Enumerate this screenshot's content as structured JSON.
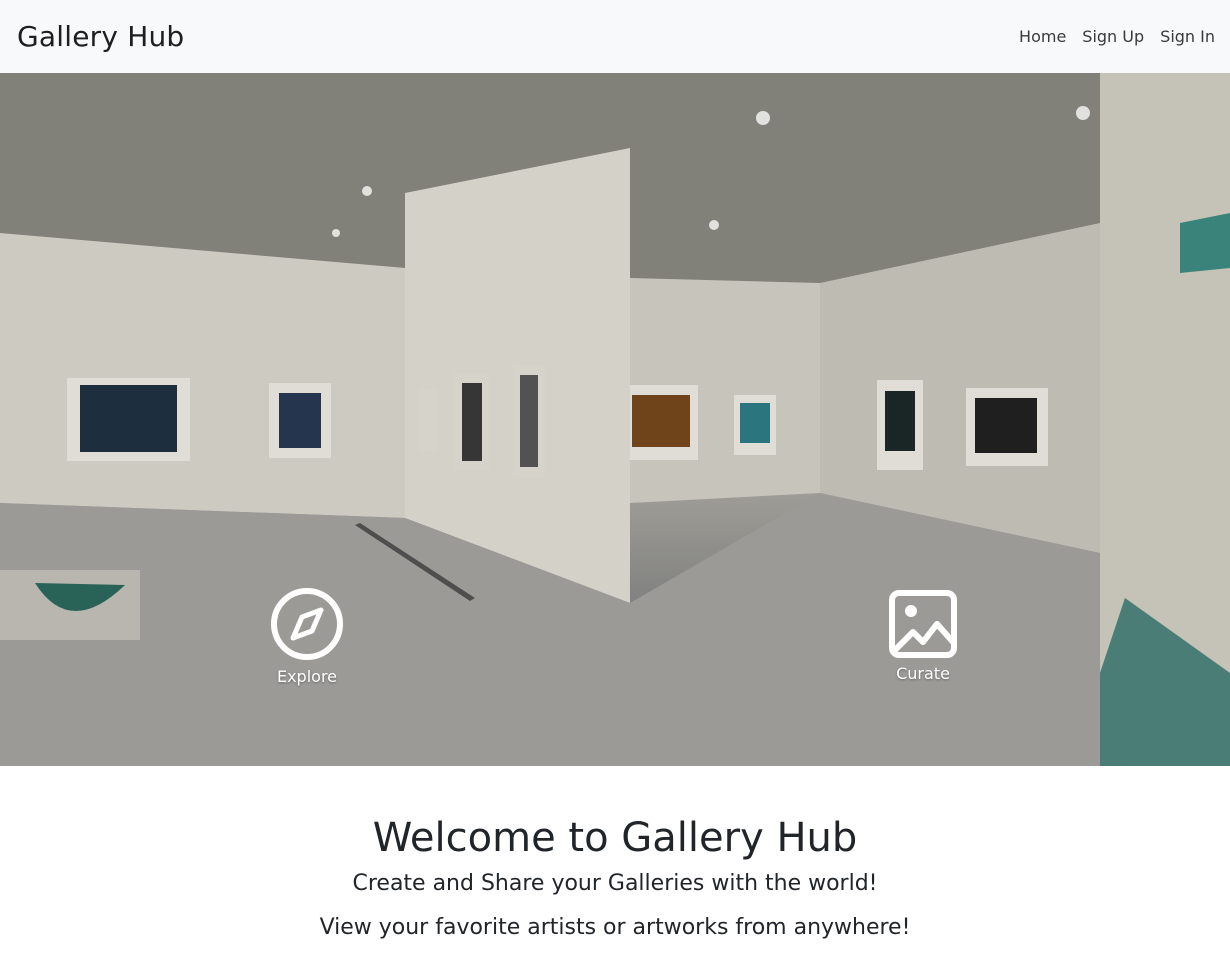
{
  "navbar": {
    "brand": "Gallery Hub",
    "links": [
      {
        "label": "Home"
      },
      {
        "label": "Sign Up"
      },
      {
        "label": "Sign In"
      }
    ]
  },
  "hero": {
    "actions": [
      {
        "label": "Explore",
        "icon": "compass-icon"
      },
      {
        "label": "Curate",
        "icon": "image-icon"
      }
    ]
  },
  "welcome": {
    "title": "Welcome to Gallery Hub",
    "line1": "Create and Share your Galleries with the world!",
    "line2": "View your favorite artists or artworks from anywhere!"
  },
  "colors": {
    "navbar_bg": "#f8f9fa",
    "text": "#212529",
    "icon": "#ffffff"
  }
}
